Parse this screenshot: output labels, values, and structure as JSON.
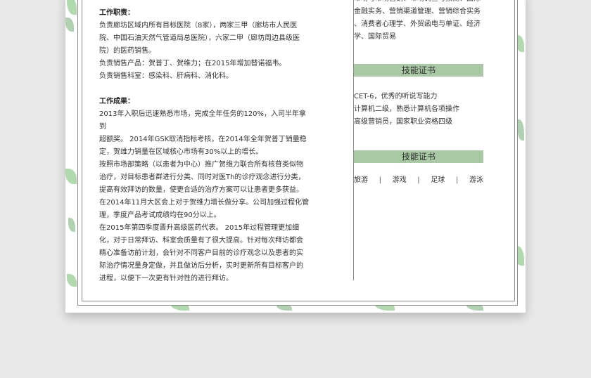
{
  "work_duties": {
    "title": "工作职责：",
    "lines": [
      "负责廊坊区域内所有目标医院（8家），两家三甲（廊坊市人民医",
      "院、中国石油天然气管道局总医院），六家二甲（廊坊周边县级医",
      "院）的医药销售。",
      "负责销售产品：贺普丁、贺维力；在2015年增加替诺福韦。",
      "负责销售科室：感染科、肝病科、消化科。"
    ]
  },
  "work_results": {
    "title": "工作成果：",
    "lines": [
      "2013年入职后迅速熟悉市场，完成全年任务的120%，入司半年拿到",
      "超额奖。  2014年GSK取消指标考核，在2014年全年贺普丁销量稳",
      "定，贺维力销量在区域核心市场有30%以上的增长。",
      "按照市场部策略（以患者为中心）推广贺维力联合所有核苷类似物",
      "治疗，对目标患者群进行分类、同时对医Th的诊疗观念进行分类，",
      "提高有效拜访的数量，使更合适的治疗方案可以让患者更多获益。",
      "在2014年11月大区会上对于贺维力增长做分享。公司加强过程化管",
      "理，季度产品考试成绩均在90分以上。",
      "在2015年第四季度晋升高级医药代表。 2015年过程管理更加细",
      "化，对于日常拜访、科室会质量有了很大提高。针对每次拜访都会",
      "精心准备访前计划，会针对不同客户目前的诊疗观念以及患者的实",
      "际治疗情况量身定做，并且做访后分析，实时更新所有目标客户的",
      "进程，以便下一次更有针对性的进行拜访。"
    ]
  },
  "courses": {
    "lines": [
      "市场与市场营销、市场调查与预测、国际",
      "金融实务、营销渠道管理、营销综合实务",
      "、消费者心理学、外贸函电与单证、经济",
      "学、国际贸易"
    ]
  },
  "skills": {
    "title": "技能证书",
    "lines": [
      "CET-6，优秀的听说写能力",
      "计算机二级，熟悉计算机各项操作",
      "高级营销员，国家职业资格四级"
    ]
  },
  "hobbies": {
    "title": "技能证书",
    "items": [
      "旅游",
      "游戏",
      "足球",
      "游泳"
    ],
    "separator": "|"
  },
  "colors": {
    "bar": "#a8c9a4",
    "leaf": "#6fb96a",
    "frame": "#8a8a8a"
  }
}
